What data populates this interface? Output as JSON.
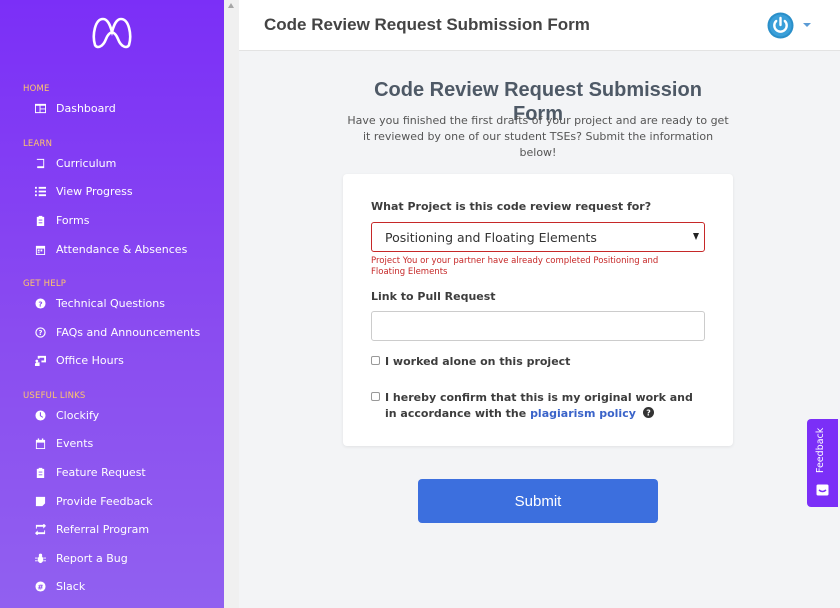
{
  "colors": {
    "sidebar": "#7b2ff7",
    "accent": "#3c6fde",
    "error": "#c62828",
    "section_title": "#ffc66a"
  },
  "header": {
    "title": "Code Review Request Submission Form",
    "user_icon": "power-icon"
  },
  "sidebar": {
    "logo_icon": "logo-icon",
    "sections": [
      {
        "title": "HOME",
        "items": [
          {
            "label": "Dashboard",
            "icon": "dashboard-icon"
          }
        ]
      },
      {
        "title": "LEARN",
        "items": [
          {
            "label": "Curriculum",
            "icon": "book-icon"
          },
          {
            "label": "View Progress",
            "icon": "list-icon"
          },
          {
            "label": "Forms",
            "icon": "clipboard-icon"
          },
          {
            "label": "Attendance & Absences",
            "icon": "calendar-icon"
          }
        ]
      },
      {
        "title": "GET HELP",
        "items": [
          {
            "label": "Technical Questions",
            "icon": "question-circle-icon"
          },
          {
            "label": "FAQs and Announcements",
            "icon": "question-circle-outline-icon"
          },
          {
            "label": "Office Hours",
            "icon": "teacher-icon"
          }
        ]
      },
      {
        "title": "USEFUL LINKS",
        "items": [
          {
            "label": "Clockify",
            "icon": "clock-icon"
          },
          {
            "label": "Events",
            "icon": "calendar-events-icon"
          },
          {
            "label": "Feature Request",
            "icon": "clipboard-list-icon"
          },
          {
            "label": "Provide Feedback",
            "icon": "note-icon"
          },
          {
            "label": "Referral Program",
            "icon": "retweet-icon"
          },
          {
            "label": "Report a Bug",
            "icon": "bug-icon"
          },
          {
            "label": "Slack",
            "icon": "slack-icon"
          }
        ]
      }
    ]
  },
  "main": {
    "heading": "Code Review Request Submission Form",
    "intro": "Have you finished the first drafts of your project and are ready to get it reviewed by one of our student TSEs? Submit the information below!"
  },
  "form": {
    "project_label": "What Project is this code review request for?",
    "project_value": "Positioning and Floating Elements",
    "project_error": "Project You or your partner have already completed Positioning and Floating Elements",
    "pr_label": "Link to Pull Request",
    "pr_value": "",
    "alone_label": "I worked alone on this project",
    "confirm_label": "I hereby confirm that this is my original work and in accordance with the",
    "policy_link": "plagiarism policy",
    "submit_label": "Submit"
  },
  "feedback_tab": {
    "label": "Feedback"
  }
}
